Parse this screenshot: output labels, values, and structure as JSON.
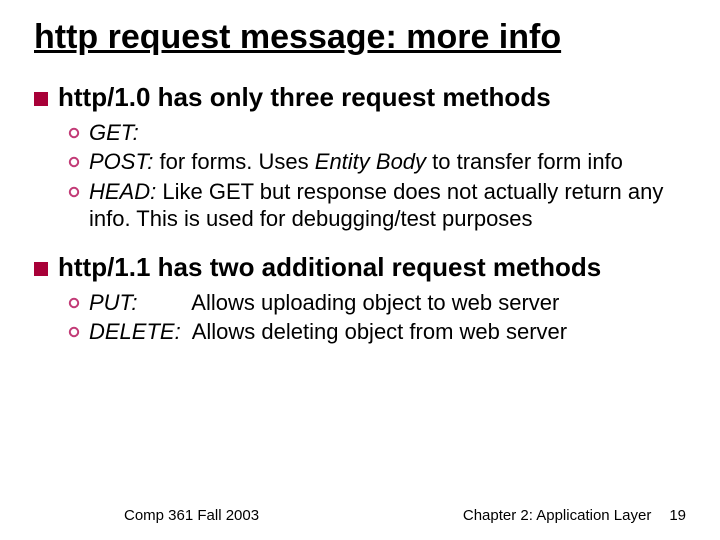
{
  "title": "http request message: more info",
  "sec1": {
    "heading": "http/1.0 has only three request methods",
    "items": {
      "get": {
        "name": "GET:",
        "desc": ""
      },
      "post": {
        "name": "POST:",
        "desc_a": "for forms.  Uses ",
        "desc_em": "Entity Body",
        "desc_b": " to transfer form info"
      },
      "head": {
        "name": "HEAD:",
        "desc": "Like GET but response does not actually return any info.  This is used for debugging/test purposes"
      }
    }
  },
  "sec2": {
    "heading": "http/1.1 has two additional request methods",
    "items": {
      "put": {
        "name": "PUT:",
        "desc": "Allows uploading object to web server"
      },
      "delete": {
        "name": "DELETE:",
        "desc": "Allows deleting object from web server"
      }
    }
  },
  "footer": {
    "left": "Comp 361   Fall 2003",
    "chapter": "Chapter 2: Application Layer",
    "page": "19"
  },
  "colors": {
    "square_fill": "#a80038",
    "circle_stroke": "#c23a76"
  }
}
